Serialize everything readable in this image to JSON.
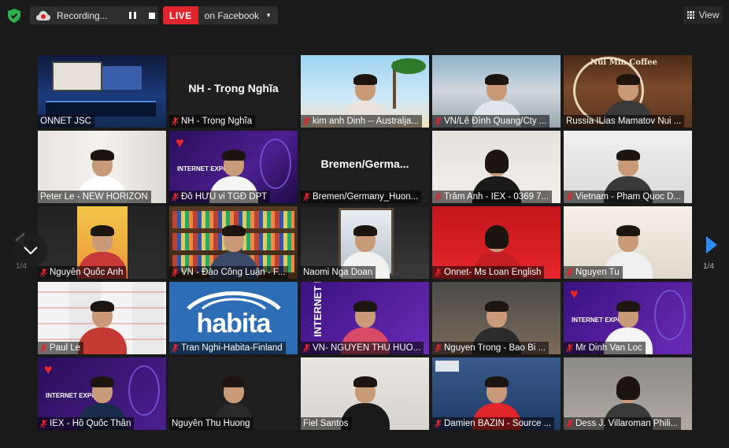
{
  "topbar": {
    "recording_label": "Recording...",
    "live_label": "LIVE",
    "live_destination": "on Facebook",
    "view_label": "View"
  },
  "pager": {
    "left_indicator": "1/4",
    "right_indicator": "1/4"
  },
  "colors": {
    "active_speaker": "#a6d56b",
    "live_red": "#e0262c",
    "muted_mic": "#e0262c",
    "next_arrow": "#2d8cff"
  },
  "participants": [
    {
      "name": "ONNET JSC",
      "muted": false
    },
    {
      "name": "NH - Trọng Nghĩa",
      "muted": true,
      "center_label": "NH - Trọng Nghĩa"
    },
    {
      "name": "kim anh Dinh -- Australja...",
      "muted": true
    },
    {
      "name": "VN/Lê Đình Quang/Cty ...",
      "muted": true
    },
    {
      "name": "Russia ILias Mamatov Nui ...",
      "muted": false,
      "active": true
    },
    {
      "name": "Peter Le - NEW HORIZON",
      "muted": false
    },
    {
      "name": "Đỗ HỮU vi TGĐ DPT",
      "muted": true
    },
    {
      "name": "Bremen/Germany_Huon...",
      "muted": true,
      "center_label": "Bremen/Germa..."
    },
    {
      "name": "Trâm Anh - IEX - 0369 7...",
      "muted": true
    },
    {
      "name": "Vietnam - Pham Quoc D...",
      "muted": true
    },
    {
      "name": "Nguyễn Quốc Anh",
      "muted": true
    },
    {
      "name": "VN - Đào Công Luận - F...",
      "muted": true
    },
    {
      "name": "Naomi Nga Doan",
      "muted": false
    },
    {
      "name": "Onnet- Ms Loan English",
      "muted": true
    },
    {
      "name": "Nguyen Tu",
      "muted": true
    },
    {
      "name": "Paul Le",
      "muted": true
    },
    {
      "name": "Tran Nghi-Habita-Finland",
      "muted": true
    },
    {
      "name": "VN- NGUYEN THU HUO...",
      "muted": true
    },
    {
      "name": "Nguyen Trong - Bao Bi ...",
      "muted": true
    },
    {
      "name": "Mr Dinh Van Loc",
      "muted": true
    },
    {
      "name": "IEX - Hồ Quốc Thân",
      "muted": true
    },
    {
      "name": "Nguyễn Thu Huong",
      "muted": false
    },
    {
      "name": "Fiel Santos",
      "muted": false
    },
    {
      "name": "Damien BAZIN - Source ...",
      "muted": true
    },
    {
      "name": "Dess J. Villaroman  Phili...",
      "muted": true
    }
  ],
  "backgrounds": {
    "habita_logo": "habita",
    "expo_text": "INTERNET EXPO",
    "coffee_text": "Núi Min Coffee"
  }
}
